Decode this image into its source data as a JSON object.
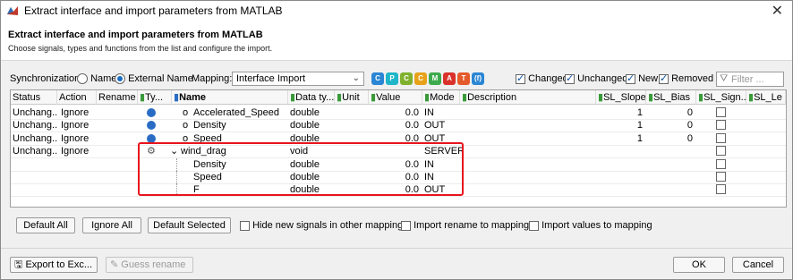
{
  "window": {
    "title": "Extract interface and import parameters from MATLAB"
  },
  "header": {
    "title": "Extract interface and import parameters from MATLAB",
    "subtitle": "Choose signals, types and functions from the list and configure the import."
  },
  "toolbar": {
    "sync_label": "Synchronization:",
    "sync_name": "Name",
    "sync_external": "External Name",
    "mapping_label": "Mapping:",
    "mapping_value": "Interface Import",
    "filter_buttons": [
      {
        "letter": "C",
        "color": "#2a86d4"
      },
      {
        "letter": "P",
        "color": "#1fb6c9"
      },
      {
        "letter": "C",
        "color": "#7fb12e"
      },
      {
        "letter": "C",
        "color": "#e7a21a"
      },
      {
        "letter": "M",
        "color": "#3daa4d"
      },
      {
        "letter": "A",
        "color": "#d9322a"
      },
      {
        "letter": "T",
        "color": "#e55a2a"
      },
      {
        "letter": "(f)",
        "color": "#2a86d4"
      }
    ],
    "changed": "Changed",
    "unchanged": "Unchanged",
    "new": "New",
    "removed": "Removed",
    "filter_placeholder": "Filter ..."
  },
  "grid": {
    "headers": {
      "status": "Status",
      "action": "Action",
      "rename": "Rename",
      "type": "Ty...",
      "name": "Name",
      "datatype": "Data ty...",
      "unit": "Unit",
      "value": "Value",
      "mode": "Mode",
      "description": "Description",
      "sl_slope": "SL_Slope",
      "sl_bias": "SL_Bias",
      "sl_sign": "SL_Sign...",
      "sl_le": "SL_Le"
    },
    "rows": [
      {
        "status": "Unchang...",
        "action": "Ignore",
        "name": "Accelerated_Speed",
        "datatype": "double",
        "value": "0.0",
        "mode": "IN",
        "slope": "1",
        "bias": "0"
      },
      {
        "status": "Unchang...",
        "action": "Ignore",
        "name": "Density",
        "datatype": "double",
        "value": "0.0",
        "mode": "OUT",
        "slope": "1",
        "bias": "0"
      },
      {
        "status": "Unchang...",
        "action": "Ignore",
        "name": "Speed",
        "datatype": "double",
        "value": "0.0",
        "mode": "OUT",
        "slope": "1",
        "bias": "0"
      },
      {
        "status": "Unchang...",
        "action": "Ignore",
        "name": "wind_drag",
        "datatype": "void",
        "value": "",
        "mode": "SERVER",
        "slope": "",
        "bias": ""
      },
      {
        "status": "",
        "action": "",
        "name": "Density",
        "datatype": "double",
        "value": "0.0",
        "mode": "IN",
        "slope": "",
        "bias": ""
      },
      {
        "status": "",
        "action": "",
        "name": "Speed",
        "datatype": "double",
        "value": "0.0",
        "mode": "IN",
        "slope": "",
        "bias": ""
      },
      {
        "status": "",
        "action": "",
        "name": "F",
        "datatype": "double",
        "value": "0.0",
        "mode": "OUT",
        "slope": "",
        "bias": ""
      }
    ]
  },
  "actions": {
    "default_all": "Default All",
    "ignore_all": "Ignore All",
    "default_selected": "Default Selected",
    "hide_new": "Hide new signals in other mappings",
    "import_rename": "Import rename to mapping",
    "import_values": "Import values to mapping"
  },
  "footer": {
    "export": "Export to Exc...",
    "guess": "Guess rename",
    "ok": "OK",
    "cancel": "Cancel"
  }
}
